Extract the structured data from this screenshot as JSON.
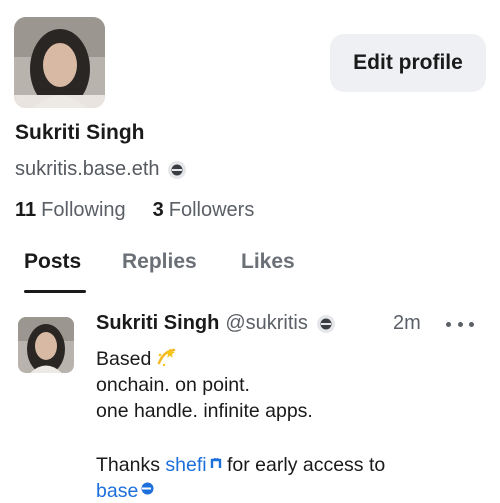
{
  "profile": {
    "display_name": "Sukriti Singh",
    "basename": "sukritis.base.eth",
    "edit_button": "Edit profile",
    "following_count": "11",
    "following_label": "Following",
    "followers_count": "3",
    "followers_label": "Followers"
  },
  "tabs": [
    {
      "label": "Posts",
      "active": true
    },
    {
      "label": "Replies",
      "active": false
    },
    {
      "label": "Likes",
      "active": false
    }
  ],
  "post": {
    "author_name": "Sukriti Singh",
    "author_handle": "@sukritis",
    "time": "2m",
    "line1": "Based",
    "line2": "onchain. on point.",
    "line3": "one handle. infinite apps.",
    "line5_prefix": "Thanks",
    "mention": "shefi",
    "line5_suffix": "for early access to",
    "base_link": "base"
  },
  "colors": {
    "link": "#1d6fdc",
    "button_bg": "#eef0f3",
    "muted_text": "#5b6067"
  },
  "icons": {
    "basename_badge": "base-circle-icon",
    "sparkle": "dizzy-sparkle-emoji",
    "more": "ellipsis-icon"
  }
}
